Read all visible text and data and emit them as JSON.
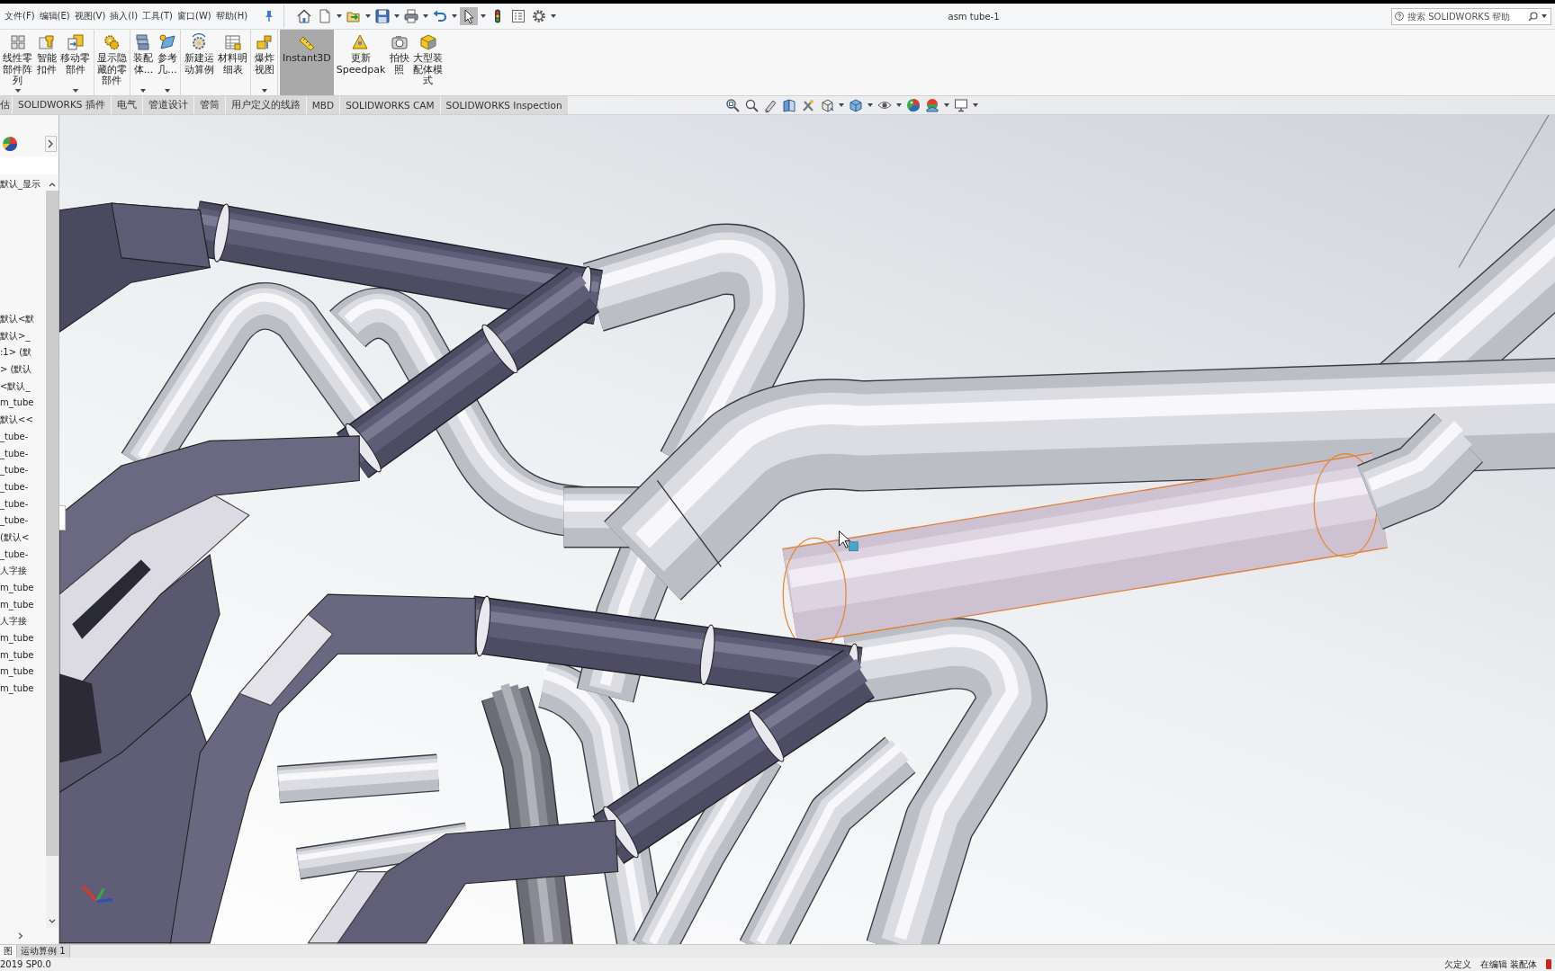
{
  "window": {
    "title": "asm tube-1"
  },
  "menu_bar": [
    "文件(F)",
    "编辑(E)",
    "视图(V)",
    "插入(I)",
    "工具(T)",
    "窗口(W)",
    "帮助(H)"
  ],
  "quick_access": [
    {
      "kind": "home",
      "dropdown": false,
      "selected": false
    },
    {
      "kind": "new",
      "dropdown": true,
      "selected": false
    },
    {
      "kind": "open",
      "dropdown": true,
      "selected": false
    },
    {
      "kind": "save",
      "dropdown": true,
      "selected": false
    },
    {
      "kind": "print",
      "dropdown": true,
      "selected": false
    },
    {
      "kind": "undo",
      "dropdown": true,
      "selected": false
    },
    {
      "kind": "select",
      "dropdown": true,
      "selected": true
    },
    {
      "kind": "rebuild",
      "dropdown": false,
      "selected": false
    },
    {
      "kind": "properties",
      "dropdown": false,
      "selected": false
    },
    {
      "kind": "options",
      "dropdown": true,
      "selected": false
    }
  ],
  "search": {
    "placeholder": "搜索 SOLIDWORKS 帮助"
  },
  "ribbon": {
    "groups": [
      {
        "buttons": [
          {
            "kind": "linear_pattern",
            "label": "线性零部件阵列",
            "dropdown": true,
            "selected": false
          },
          {
            "kind": "smart_fastener",
            "label": "智能扣件",
            "dropdown": false,
            "selected": false
          },
          {
            "kind": "move_component",
            "label": "移动零部件",
            "dropdown": true,
            "selected": false
          }
        ]
      },
      {
        "buttons": [
          {
            "kind": "show_hidden",
            "label": "显示隐藏的零部件",
            "dropdown": false,
            "selected": false
          }
        ]
      },
      {
        "buttons": [
          {
            "kind": "assembly",
            "label": "装配体...",
            "dropdown": true,
            "selected": false
          },
          {
            "kind": "reference_geometry",
            "label": "参考几...",
            "dropdown": true,
            "selected": false
          }
        ]
      },
      {
        "buttons": [
          {
            "kind": "motion_study",
            "label": "新建运动算例",
            "dropdown": false,
            "selected": false
          },
          {
            "kind": "bom",
            "label": "材料明细表",
            "dropdown": false,
            "selected": false
          }
        ]
      },
      {
        "buttons": [
          {
            "kind": "exploded_view",
            "label": "爆炸视图",
            "dropdown": true,
            "selected": false
          }
        ]
      },
      {
        "buttons": [
          {
            "kind": "instant3d",
            "label": "Instant3D",
            "dropdown": false,
            "selected": true
          },
          {
            "kind": "speedpak",
            "label": "更新Speedpak",
            "dropdown": false,
            "selected": false
          },
          {
            "kind": "snapshot",
            "label": "拍快照",
            "dropdown": false,
            "selected": false
          },
          {
            "kind": "large_assembly",
            "label": "大型装配体模式",
            "dropdown": false,
            "selected": false
          }
        ]
      }
    ]
  },
  "command_tabs": [
    {
      "label": "估",
      "selected": false
    },
    {
      "label": "SOLIDWORKS 插件",
      "selected": false
    },
    {
      "label": "电气",
      "selected": false
    },
    {
      "label": "管道设计",
      "selected": false
    },
    {
      "label": "管筒",
      "selected": false
    },
    {
      "label": "用户定义的线路",
      "selected": false
    },
    {
      "label": "MBD",
      "selected": false
    },
    {
      "label": "SOLIDWORKS CAM",
      "selected": false
    },
    {
      "label": "SOLIDWORKS Inspection",
      "selected": false
    }
  ],
  "view_toolbar": [
    {
      "kind": "zoom_fit",
      "dropdown": false
    },
    {
      "kind": "zoom_area",
      "dropdown": false
    },
    {
      "kind": "previous_view",
      "dropdown": false
    },
    {
      "kind": "section_view",
      "dropdown": false
    },
    {
      "kind": "dynamic_annotation",
      "dropdown": false
    },
    {
      "kind": "view_orientation",
      "dropdown": true
    },
    {
      "kind": "display_style",
      "dropdown": true
    },
    {
      "kind": "hide_show",
      "dropdown": true
    },
    {
      "kind": "appearance",
      "dropdown": false
    },
    {
      "kind": "scene",
      "dropdown": true
    },
    {
      "kind": "view_settings",
      "dropdown": true
    }
  ],
  "feature_tree": {
    "header": "默认_显示",
    "items": [
      "默认<默",
      "默认>_",
      ":1> (默",
      "> (默认",
      "<默认_",
      "m_tube",
      "默认<<",
      "_tube-",
      "_tube-",
      "_tube-",
      "_tube-",
      "_tube-",
      "_tube-",
      "(默认<",
      "_tube-",
      "人字接",
      "m_tube",
      "m_tube",
      "人字接",
      "m_tube",
      "m_tube",
      "m_tube",
      "m_tube"
    ]
  },
  "bottom_tabs": [
    {
      "label": "图",
      "selected": true
    },
    {
      "label": "运动算例 1",
      "selected": false
    }
  ],
  "status_bar": {
    "version": "2019 SP0.0",
    "definition": "欠定义",
    "mode": "在编辑 装配体"
  }
}
